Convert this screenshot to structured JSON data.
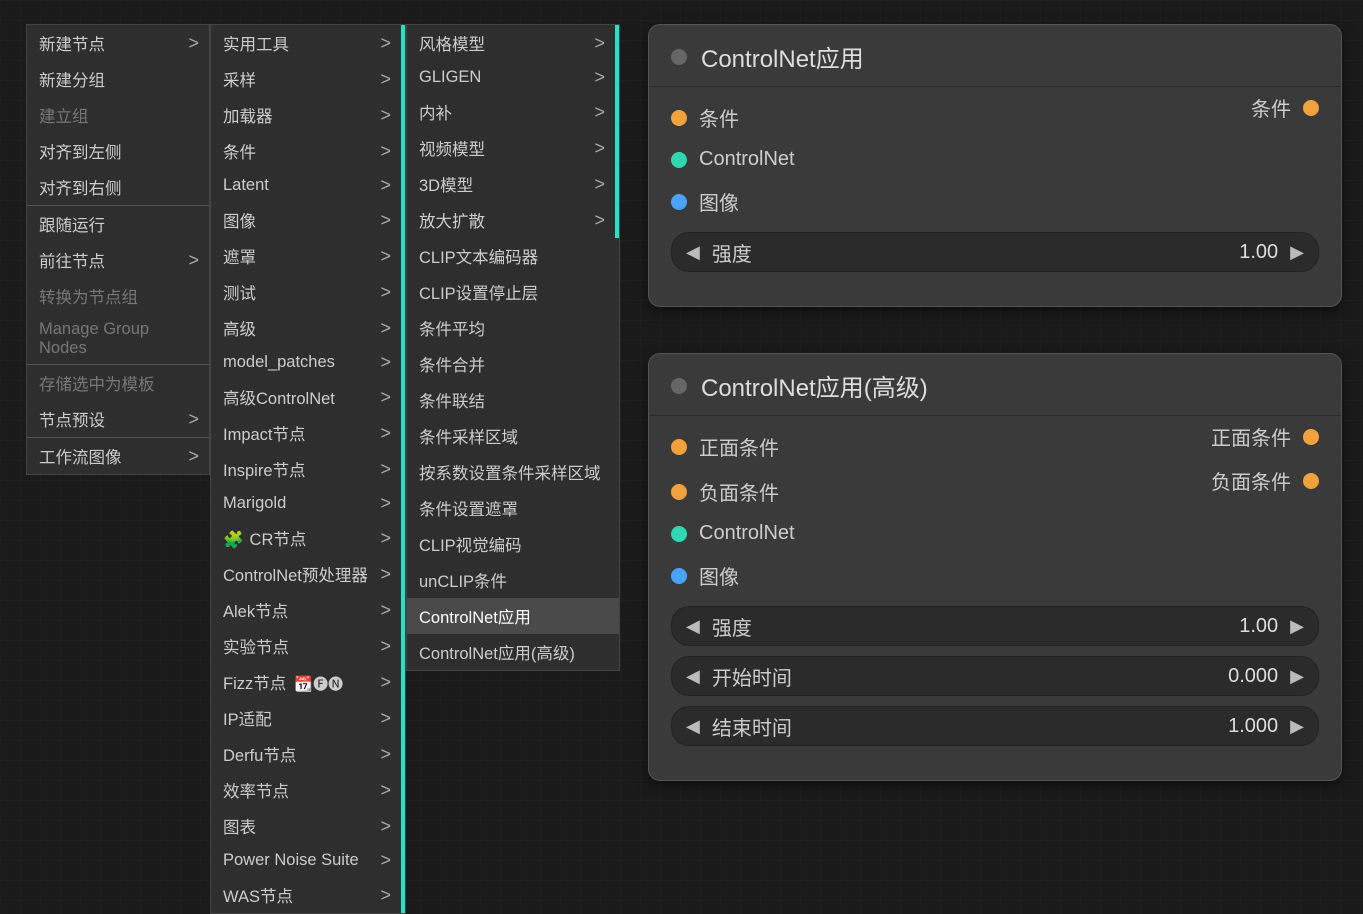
{
  "menu0": {
    "items": [
      {
        "label": "新建节点",
        "arrow": true
      },
      {
        "label": "新建分组"
      },
      {
        "label": "建立组",
        "disabled": true
      },
      {
        "label": "对齐到左侧"
      },
      {
        "label": "对齐到右侧"
      },
      {
        "sep": true
      },
      {
        "label": "跟随运行"
      },
      {
        "label": "前往节点",
        "arrow": true
      },
      {
        "label": "转换为节点组",
        "disabled": true
      },
      {
        "label": "Manage Group Nodes",
        "disabled": true
      },
      {
        "sep": true
      },
      {
        "label": "存储选中为模板",
        "disabled": true
      },
      {
        "label": "节点预设",
        "arrow": true
      },
      {
        "sep": true
      },
      {
        "label": "工作流图像",
        "arrow": true
      }
    ]
  },
  "menu1": {
    "items": [
      {
        "label": "实用工具",
        "arrow": true,
        "bar": "r"
      },
      {
        "label": "采样",
        "arrow": true,
        "bar": "r"
      },
      {
        "label": "加载器",
        "arrow": true,
        "bar": "r"
      },
      {
        "label": "条件",
        "arrow": true,
        "bar": "r"
      },
      {
        "label": "Latent",
        "arrow": true,
        "bar": "r"
      },
      {
        "label": "图像",
        "arrow": true,
        "bar": "r"
      },
      {
        "label": "遮罩",
        "arrow": true,
        "bar": "r"
      },
      {
        "label": "测试",
        "arrow": true,
        "bar": "r"
      },
      {
        "label": "高级",
        "arrow": true,
        "bar": "r"
      },
      {
        "label": "model_patches",
        "arrow": true,
        "bar": "r"
      },
      {
        "label": "高级ControlNet",
        "arrow": true,
        "bar": "r"
      },
      {
        "label": "Impact节点",
        "arrow": true,
        "bar": "r"
      },
      {
        "label": "Inspire节点",
        "arrow": true,
        "bar": "r"
      },
      {
        "label": "Marigold",
        "arrow": true,
        "bar": "r"
      },
      {
        "label": "CR节点",
        "arrow": true,
        "bar": "r",
        "jigsaw": true
      },
      {
        "label": "ControlNet预处理器",
        "arrow": true,
        "bar": "r"
      },
      {
        "label": "Alek节点",
        "arrow": true,
        "bar": "r"
      },
      {
        "label": "实验节点",
        "arrow": true,
        "bar": "r"
      },
      {
        "label": "Fizz节点",
        "arrow": true,
        "bar": "r",
        "icons": "📆🅕🅝"
      },
      {
        "label": "IP适配",
        "arrow": true,
        "bar": "r"
      },
      {
        "label": "Derfu节点",
        "arrow": true,
        "bar": "r"
      },
      {
        "label": "效率节点",
        "arrow": true,
        "bar": "r"
      },
      {
        "label": "图表",
        "arrow": true,
        "bar": "r"
      },
      {
        "label": "Power Noise Suite",
        "arrow": true,
        "bar": "r"
      },
      {
        "label": "WAS节点",
        "arrow": true,
        "bar": "r"
      }
    ]
  },
  "menu2": {
    "items": [
      {
        "label": "风格模型",
        "arrow": true,
        "bar": "r"
      },
      {
        "label": "GLIGEN",
        "arrow": true,
        "bar": "r"
      },
      {
        "label": "内补",
        "arrow": true,
        "bar": "r"
      },
      {
        "label": "视频模型",
        "arrow": true,
        "bar": "r"
      },
      {
        "label": "3D模型",
        "arrow": true,
        "bar": "r"
      },
      {
        "label": "放大扩散",
        "arrow": true,
        "bar": "r"
      },
      {
        "label": "CLIP文本编码器"
      },
      {
        "label": "CLIP设置停止层"
      },
      {
        "label": "条件平均"
      },
      {
        "label": "条件合并"
      },
      {
        "label": "条件联结"
      },
      {
        "label": "条件采样区域"
      },
      {
        "label": "按系数设置条件采样区域"
      },
      {
        "label": "条件设置遮罩"
      },
      {
        "label": "CLIP视觉编码"
      },
      {
        "label": "unCLIP条件"
      },
      {
        "label": "ControlNet应用",
        "hl": true
      },
      {
        "label": "ControlNet应用(高级)"
      }
    ]
  },
  "node1": {
    "title": "ControlNet应用",
    "inputs": [
      {
        "label": "条件",
        "color": "d-orange"
      },
      {
        "label": "ControlNet",
        "color": "d-teal"
      },
      {
        "label": "图像",
        "color": "d-blue"
      }
    ],
    "outputs": [
      {
        "label": "条件",
        "color": "d-orange"
      }
    ],
    "widgets": [
      {
        "label": "强度",
        "value": "1.00"
      }
    ]
  },
  "node2": {
    "title": "ControlNet应用(高级)",
    "inputs": [
      {
        "label": "正面条件",
        "color": "d-orange"
      },
      {
        "label": "负面条件",
        "color": "d-orange"
      },
      {
        "label": "ControlNet",
        "color": "d-teal"
      },
      {
        "label": "图像",
        "color": "d-blue"
      }
    ],
    "outputs": [
      {
        "label": "正面条件",
        "color": "d-orange"
      },
      {
        "label": "负面条件",
        "color": "d-orange"
      }
    ],
    "widgets": [
      {
        "label": "强度",
        "value": "1.00"
      },
      {
        "label": "开始时间",
        "value": "0.000"
      },
      {
        "label": "结束时间",
        "value": "1.000"
      }
    ]
  }
}
